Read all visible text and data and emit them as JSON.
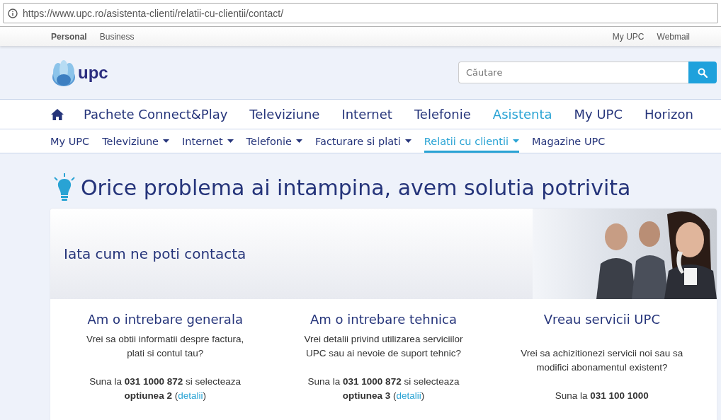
{
  "browser": {
    "url": "https://www.upc.ro/asistenta-clienti/relatii-cu-clientii/contact/"
  },
  "top_bar": {
    "left": [
      {
        "label": "Personal",
        "selected": true
      },
      {
        "label": "Business",
        "selected": false
      }
    ],
    "right": [
      "My UPC",
      "Webmail"
    ]
  },
  "header": {
    "logo": "upc",
    "search": {
      "placeholder": "Căutare"
    }
  },
  "main_nav": [
    {
      "label": "Pachete Connect&Play",
      "selected": false
    },
    {
      "label": "Televiziune",
      "selected": false
    },
    {
      "label": "Internet",
      "selected": false
    },
    {
      "label": "Telefonie",
      "selected": false
    },
    {
      "label": "Asistenta",
      "selected": true
    },
    {
      "label": "My UPC",
      "selected": false
    },
    {
      "label": "Horizon",
      "selected": false
    }
  ],
  "sub_nav": [
    {
      "label": "My UPC",
      "dropdown": false,
      "selected": false
    },
    {
      "label": "Televiziune",
      "dropdown": true,
      "selected": false
    },
    {
      "label": "Internet",
      "dropdown": true,
      "selected": false
    },
    {
      "label": "Telefonie",
      "dropdown": true,
      "selected": false
    },
    {
      "label": "Facturare si plati",
      "dropdown": true,
      "selected": false
    },
    {
      "label": "Relatii cu clientii",
      "dropdown": true,
      "selected": true
    },
    {
      "label": "Magazine UPC",
      "dropdown": false,
      "selected": false
    }
  ],
  "page_title": "Orice problema ai intampina, avem solutia potrivita",
  "banner": {
    "title": "Iata cum ne poti contacta"
  },
  "columns": [
    {
      "title": "Am o intrebare generala",
      "description": "Vrei sa obtii informatii despre factura, plati si contul tau?",
      "call": "Suna la **031 1000 872** si selecteaza **optiunea 2** (",
      "link": "detalii",
      "after": ")"
    },
    {
      "title": "Am o intrebare tehnica",
      "description": "Vrei detalii privind utilizarea serviciilor UPC sau ai nevoie de suport tehnic?",
      "call": "Suna la **031 1000 872** si selecteaza **optiunea 3** (",
      "link": "detalii",
      "after": ")"
    },
    {
      "title": "Vreau servicii UPC",
      "description": "Vrei sa achizitionezi servicii noi sau sa modifici abonamentul existent?",
      "call": "Suna la **031 100 1000**"
    }
  ]
}
